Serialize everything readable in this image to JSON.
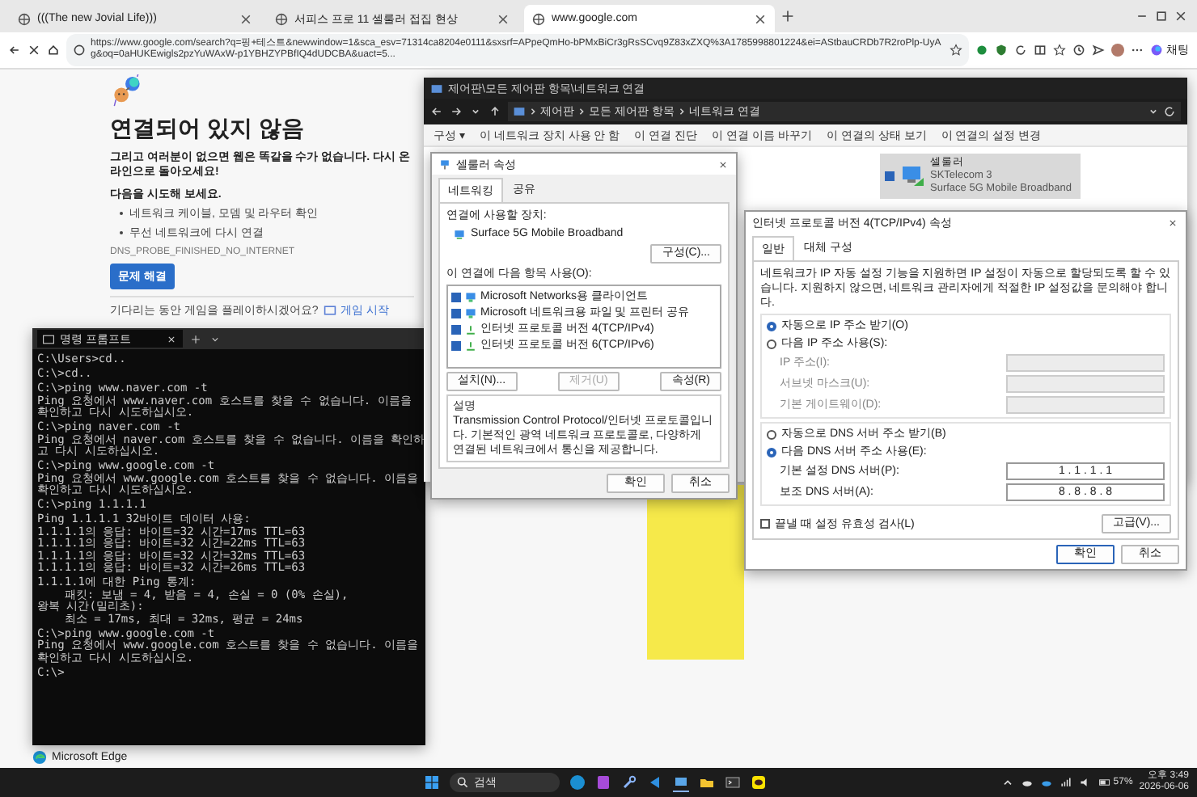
{
  "browser": {
    "tabs": [
      {
        "title": "(((The new Jovial Life)))",
        "selected": false
      },
      {
        "title": "서피스 프로 11 셀룰러 접집 현상",
        "selected": false
      },
      {
        "title": "www.google.com",
        "selected": true
      }
    ],
    "url": "https://www.google.com/search?q=핑+테스트&newwindow=1&sca_esv=71314ca8204e0111&sxsrf=APpeQmHo-bPMxBiCr3gRsSCvq9Z83xZXQ%3A1785998801224&ei=AStbauCRDb7R2roPlp-UyAg&oq=0aHUKEwigls2pzYuWAxW-p1YBHZYPBfIQ4dUDCBA&uact=5...",
    "chat_label": "채팅"
  },
  "error_page": {
    "heading": "연결되어 있지 않음",
    "subtitle": "그리고 여러분이 없으면 웹은 똑같을 수가 없습니다. 다시 온라인으로 돌아오세요!",
    "try_label": "다음을 시도해 보세요.",
    "suggestions": [
      "네트워크 케이블, 모뎀 및 라우터 확인",
      "무선 네트워크에 다시 연결"
    ],
    "error_code": "DNS_PROBE_FINISHED_NO_INTERNET",
    "button": "문제 해결",
    "game_prompt": "기다리는 동안 게임을 플레이하시겠어요?",
    "game_link": "게임 시작"
  },
  "app_label": "Microsoft Edge",
  "terminal": {
    "tab_title": "명령 프롬프트",
    "blocks": [
      [
        "C:\\Users>cd.."
      ],
      [
        "C:\\>cd.."
      ],
      [
        "C:\\>ping www.naver.com -t",
        "Ping 요청에서 www.naver.com 호스트를 찾을 수 없습니다. 이름을 확인하고 다시 시도하십시오."
      ],
      [
        "C:\\>ping naver.com -t",
        "Ping 요청에서 naver.com 호스트를 찾을 수 없습니다. 이름을 확인하고 다시 시도하십시오."
      ],
      [
        "C:\\>ping www.google.com -t",
        "Ping 요청에서 www.google.com 호스트를 찾을 수 없습니다. 이름을 확인하고 다시 시도하십시오."
      ],
      [
        "C:\\>ping 1.1.1.1"
      ],
      [
        "Ping 1.1.1.1 32바이트 데이터 사용:",
        "1.1.1.1의 응답: 바이트=32 시간=17ms TTL=63",
        "1.1.1.1의 응답: 바이트=32 시간=22ms TTL=63",
        "1.1.1.1의 응답: 바이트=32 시간=32ms TTL=63",
        "1.1.1.1의 응답: 바이트=32 시간=26ms TTL=63"
      ],
      [
        "1.1.1.1에 대한 Ping 통계:",
        "    패킷: 보냄 = 4, 받음 = 4, 손실 = 0 (0% 손실),",
        "왕복 시간(밀리초):",
        "    최소 = 17ms, 최대 = 32ms, 평균 = 24ms"
      ],
      [
        "C:\\>ping www.google.com -t",
        "Ping 요청에서 www.google.com 호스트를 찾을 수 없습니다. 이름을 확인하고 다시 시도하십시오."
      ],
      [
        "C:\\>"
      ]
    ]
  },
  "explorer": {
    "title": "제어판\\모든 제어판 항목\\네트워크 연결",
    "breadcrumb": [
      "제어판",
      "모든 제어판 항목",
      "네트워크 연결"
    ],
    "toolbar": [
      "구성 ▾",
      "이 네트워크 장치 사용 안 함",
      "이 연결 진단",
      "이 연결 이름 바꾸기",
      "이 연결의 상태 보기",
      "이 연결의 설정 변경"
    ],
    "adapter": {
      "name": "셀룰러",
      "carrier": "SKTelecom 3",
      "device": "Surface 5G Mobile Broadband",
      "checked": true
    }
  },
  "properties_dialog": {
    "title": "셀룰러 속성",
    "tabs": [
      {
        "label": "네트워킹",
        "selected": true
      },
      {
        "label": "공유",
        "selected": false
      }
    ],
    "device_label": "연결에 사용할 장치:",
    "device": "Surface 5G Mobile Broadband",
    "configure_button": "구성(C)...",
    "items_label": "이 연결에 다음 항목 사용(O):",
    "items": [
      {
        "label": "Microsoft Networks용 클라이언트",
        "checked": true,
        "kind": "network"
      },
      {
        "label": "Microsoft 네트워크용 파일 및 프린터 공유",
        "checked": true,
        "kind": "network"
      },
      {
        "label": "인터넷 프로토콜 버전 4(TCP/IPv4)",
        "checked": true,
        "kind": "protocol"
      },
      {
        "label": "인터넷 프로토콜 버전 6(TCP/IPv6)",
        "checked": true,
        "kind": "protocol"
      }
    ],
    "item_buttons": [
      {
        "label": "설치(N)...",
        "disabled": false
      },
      {
        "label": "제거(U)",
        "disabled": true
      },
      {
        "label": "속성(R)",
        "disabled": false
      }
    ],
    "description_label": "설명",
    "description": "Transmission Control Protocol/인터넷 프로토콜입니다. 기본적인 광역 네트워크 프로토콜로, 다양하게 연결된 네트워크에서 통신을 제공합니다.",
    "buttons": [
      "확인",
      "취소"
    ]
  },
  "ipv4_dialog": {
    "title": "인터넷 프로토콜 버전 4(TCP/IPv4) 속성",
    "tabs": [
      {
        "label": "일반",
        "selected": true
      },
      {
        "label": "대체 구성",
        "selected": false
      }
    ],
    "description": "네트워크가 IP 자동 설정 기능을 지원하면 IP 설정이 자동으로 할당되도록 할 수 있습니다. 지원하지 않으면, 네트워크 관리자에게 적절한 IP 설정값을 문의해야 합니다.",
    "ip_options": [
      {
        "label": "자동으로 IP 주소 받기(O)",
        "selected": true
      },
      {
        "label": "다음 IP 주소 사용(S):",
        "selected": false
      }
    ],
    "ip_fields": [
      {
        "label": "IP 주소(I):",
        "disabled": true
      },
      {
        "label": "서브넷 마스크(U):",
        "disabled": true
      },
      {
        "label": "기본 게이트웨이(D):",
        "disabled": true
      }
    ],
    "dns_options": [
      {
        "label": "자동으로 DNS 서버 주소 받기(B)",
        "selected": false
      },
      {
        "label": "다음 DNS 서버 주소 사용(E):",
        "selected": true
      }
    ],
    "dns_fields": [
      {
        "label": "기본 설정 DNS 서버(P):",
        "value": "1 . 1 . 1 . 1",
        "disabled": false
      },
      {
        "label": "보조 DNS 서버(A):",
        "value": "8 . 8 . 8 . 8",
        "disabled": false
      }
    ],
    "validate": {
      "label": "끝낼 때 설정 유효성 검사(L)",
      "checked": false
    },
    "advanced_button": "고급(V)...",
    "buttons": [
      "확인",
      "취소"
    ]
  },
  "taskbar": {
    "search_placeholder": "검색",
    "battery": "57%",
    "time": "오후 3:49",
    "date": "2026-06-06"
  }
}
